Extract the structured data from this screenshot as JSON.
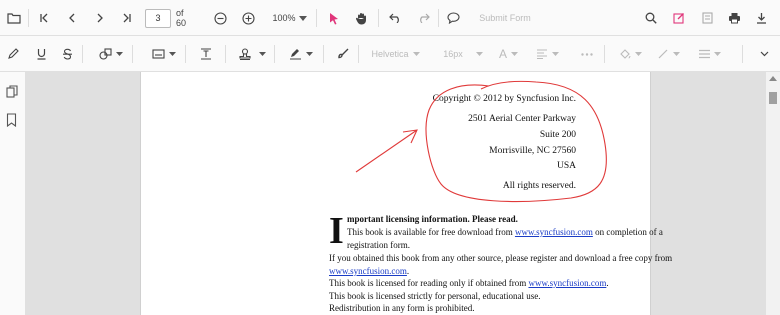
{
  "toolbar": {
    "page_number": "3",
    "page_count_label": "of 60",
    "zoom": "100%",
    "submit_form_label": "Submit Form"
  },
  "annotation_toolbar": {
    "font_family": "Helvetica",
    "font_size": "16px",
    "font_color_glyph": "A"
  },
  "document": {
    "address": {
      "copyright": "Copyright © 2012 by Syncfusion Inc.",
      "street": "2501 Aerial Center Parkway",
      "suite": "Suite 200",
      "city": "Morrisville, NC 27560",
      "country": "USA",
      "rights": "All rights reserved."
    },
    "notice": {
      "dropcap": "I",
      "heading_rest": "mportant licensing information. Please read.",
      "line1_pre": "This book is available for free download from ",
      "line1_link": "www.syncfusion.com",
      "line1_post": " on completion of a",
      "line2": "registration form.",
      "line3": "If you obtained this book from any other source, please register and download a free copy from",
      "line4_link": "www.syncfusion.com",
      "line4_post": ".",
      "line5_pre": "This book is licensed for reading only if obtained from ",
      "line5_link": "www.syncfusion.com",
      "line5_post": ".",
      "line6": "This book is licensed strictly for personal, educational use.",
      "line7": "Redistribution in any form is prohibited."
    }
  },
  "colors": {
    "accent": "#e0357a",
    "ink_annotation": "#e03a3a",
    "link": "#1a3cc6"
  }
}
